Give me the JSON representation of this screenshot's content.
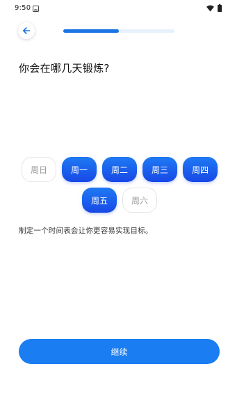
{
  "status_bar": {
    "time": "9:50",
    "notification_icon": "image-notification-icon",
    "wifi_icon": "wifi-icon",
    "battery_icon": "battery-icon"
  },
  "header": {
    "back_icon": "arrow-left-icon",
    "progress_fraction": 0.5,
    "accent_color": "#1b74e4"
  },
  "question": "你会在哪几天锻炼?",
  "days": [
    {
      "label": "周日",
      "selected": false
    },
    {
      "label": "周一",
      "selected": true
    },
    {
      "label": "周二",
      "selected": true
    },
    {
      "label": "周三",
      "selected": true
    },
    {
      "label": "周四",
      "selected": true
    },
    {
      "label": "周五",
      "selected": true
    },
    {
      "label": "周六",
      "selected": false
    }
  ],
  "hint": "制定一个时间表会让你更容易实现目标。",
  "continue_label": "继续",
  "colors": {
    "selected_top": "#1e7af3",
    "selected_bottom": "#1848e6",
    "button": "#1a7df2"
  }
}
